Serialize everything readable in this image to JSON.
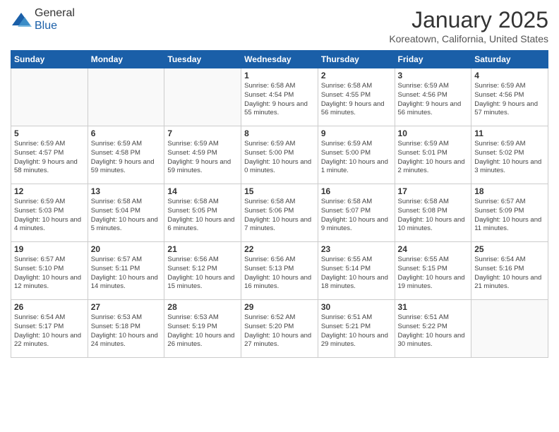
{
  "header": {
    "logo_general": "General",
    "logo_blue": "Blue",
    "month_title": "January 2025",
    "location": "Koreatown, California, United States"
  },
  "calendar": {
    "headers": [
      "Sunday",
      "Monday",
      "Tuesday",
      "Wednesday",
      "Thursday",
      "Friday",
      "Saturday"
    ],
    "weeks": [
      [
        {
          "day": "",
          "info": ""
        },
        {
          "day": "",
          "info": ""
        },
        {
          "day": "",
          "info": ""
        },
        {
          "day": "1",
          "info": "Sunrise: 6:58 AM\nSunset: 4:54 PM\nDaylight: 9 hours\nand 55 minutes."
        },
        {
          "day": "2",
          "info": "Sunrise: 6:58 AM\nSunset: 4:55 PM\nDaylight: 9 hours\nand 56 minutes."
        },
        {
          "day": "3",
          "info": "Sunrise: 6:59 AM\nSunset: 4:56 PM\nDaylight: 9 hours\nand 56 minutes."
        },
        {
          "day": "4",
          "info": "Sunrise: 6:59 AM\nSunset: 4:56 PM\nDaylight: 9 hours\nand 57 minutes."
        }
      ],
      [
        {
          "day": "5",
          "info": "Sunrise: 6:59 AM\nSunset: 4:57 PM\nDaylight: 9 hours\nand 58 minutes."
        },
        {
          "day": "6",
          "info": "Sunrise: 6:59 AM\nSunset: 4:58 PM\nDaylight: 9 hours\nand 59 minutes."
        },
        {
          "day": "7",
          "info": "Sunrise: 6:59 AM\nSunset: 4:59 PM\nDaylight: 9 hours\nand 59 minutes."
        },
        {
          "day": "8",
          "info": "Sunrise: 6:59 AM\nSunset: 5:00 PM\nDaylight: 10 hours\nand 0 minutes."
        },
        {
          "day": "9",
          "info": "Sunrise: 6:59 AM\nSunset: 5:00 PM\nDaylight: 10 hours\nand 1 minute."
        },
        {
          "day": "10",
          "info": "Sunrise: 6:59 AM\nSunset: 5:01 PM\nDaylight: 10 hours\nand 2 minutes."
        },
        {
          "day": "11",
          "info": "Sunrise: 6:59 AM\nSunset: 5:02 PM\nDaylight: 10 hours\nand 3 minutes."
        }
      ],
      [
        {
          "day": "12",
          "info": "Sunrise: 6:59 AM\nSunset: 5:03 PM\nDaylight: 10 hours\nand 4 minutes."
        },
        {
          "day": "13",
          "info": "Sunrise: 6:58 AM\nSunset: 5:04 PM\nDaylight: 10 hours\nand 5 minutes."
        },
        {
          "day": "14",
          "info": "Sunrise: 6:58 AM\nSunset: 5:05 PM\nDaylight: 10 hours\nand 6 minutes."
        },
        {
          "day": "15",
          "info": "Sunrise: 6:58 AM\nSunset: 5:06 PM\nDaylight: 10 hours\nand 7 minutes."
        },
        {
          "day": "16",
          "info": "Sunrise: 6:58 AM\nSunset: 5:07 PM\nDaylight: 10 hours\nand 9 minutes."
        },
        {
          "day": "17",
          "info": "Sunrise: 6:58 AM\nSunset: 5:08 PM\nDaylight: 10 hours\nand 10 minutes."
        },
        {
          "day": "18",
          "info": "Sunrise: 6:57 AM\nSunset: 5:09 PM\nDaylight: 10 hours\nand 11 minutes."
        }
      ],
      [
        {
          "day": "19",
          "info": "Sunrise: 6:57 AM\nSunset: 5:10 PM\nDaylight: 10 hours\nand 12 minutes."
        },
        {
          "day": "20",
          "info": "Sunrise: 6:57 AM\nSunset: 5:11 PM\nDaylight: 10 hours\nand 14 minutes."
        },
        {
          "day": "21",
          "info": "Sunrise: 6:56 AM\nSunset: 5:12 PM\nDaylight: 10 hours\nand 15 minutes."
        },
        {
          "day": "22",
          "info": "Sunrise: 6:56 AM\nSunset: 5:13 PM\nDaylight: 10 hours\nand 16 minutes."
        },
        {
          "day": "23",
          "info": "Sunrise: 6:55 AM\nSunset: 5:14 PM\nDaylight: 10 hours\nand 18 minutes."
        },
        {
          "day": "24",
          "info": "Sunrise: 6:55 AM\nSunset: 5:15 PM\nDaylight: 10 hours\nand 19 minutes."
        },
        {
          "day": "25",
          "info": "Sunrise: 6:54 AM\nSunset: 5:16 PM\nDaylight: 10 hours\nand 21 minutes."
        }
      ],
      [
        {
          "day": "26",
          "info": "Sunrise: 6:54 AM\nSunset: 5:17 PM\nDaylight: 10 hours\nand 22 minutes."
        },
        {
          "day": "27",
          "info": "Sunrise: 6:53 AM\nSunset: 5:18 PM\nDaylight: 10 hours\nand 24 minutes."
        },
        {
          "day": "28",
          "info": "Sunrise: 6:53 AM\nSunset: 5:19 PM\nDaylight: 10 hours\nand 26 minutes."
        },
        {
          "day": "29",
          "info": "Sunrise: 6:52 AM\nSunset: 5:20 PM\nDaylight: 10 hours\nand 27 minutes."
        },
        {
          "day": "30",
          "info": "Sunrise: 6:51 AM\nSunset: 5:21 PM\nDaylight: 10 hours\nand 29 minutes."
        },
        {
          "day": "31",
          "info": "Sunrise: 6:51 AM\nSunset: 5:22 PM\nDaylight: 10 hours\nand 30 minutes."
        },
        {
          "day": "",
          "info": ""
        }
      ]
    ]
  }
}
